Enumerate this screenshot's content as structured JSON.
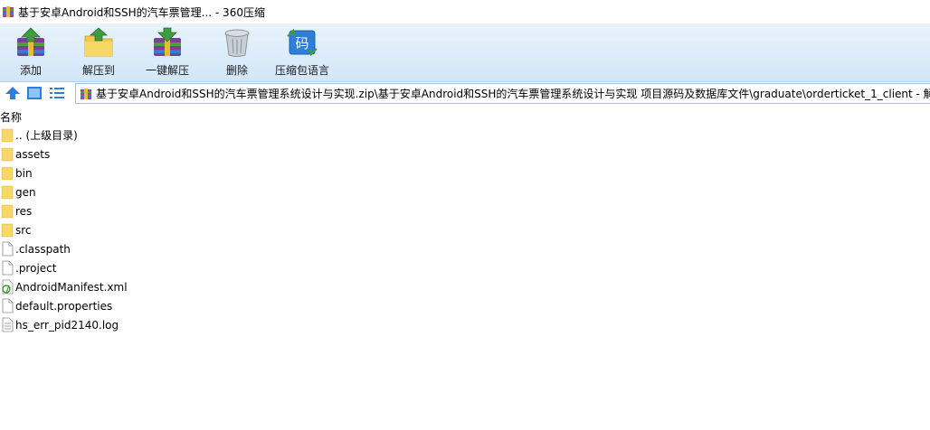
{
  "window": {
    "title": "基于安卓Android和SSH的汽车票管理... - 360压缩"
  },
  "toolbar": {
    "add_label": "添加",
    "extract_to_label": "解压到",
    "one_click_extract_label": "一键解压",
    "delete_label": "删除",
    "comment_label": "压缩包语言",
    "comment_icon_glyph": "码"
  },
  "address": {
    "path": "基于安卓Android和SSH的汽车票管理系统设计与实现.zip\\基于安卓Android和SSH的汽车票管理系统设计与实现 项目源码及数据库文件\\graduate\\orderticket_1_client - 解"
  },
  "list": {
    "column_name": "名称",
    "items": [
      {
        "name": ".. (上级目录)",
        "icon": "folder-icon"
      },
      {
        "name": "assets",
        "icon": "folder-icon"
      },
      {
        "name": "bin",
        "icon": "folder-icon"
      },
      {
        "name": "gen",
        "icon": "folder-icon"
      },
      {
        "name": "res",
        "icon": "folder-icon"
      },
      {
        "name": "src",
        "icon": "folder-icon"
      },
      {
        "name": ".classpath",
        "icon": "file-icon"
      },
      {
        "name": ".project",
        "icon": "file-icon"
      },
      {
        "name": "AndroidManifest.xml",
        "icon": "xml-file-icon"
      },
      {
        "name": "default.properties",
        "icon": "file-icon"
      },
      {
        "name": "hs_err_pid2140.log",
        "icon": "log-file-icon"
      }
    ]
  },
  "colors": {
    "toolbar_top": "#e8f3fd",
    "toolbar_bottom": "#d2e6f8",
    "folder": "#f7d766",
    "accent_blue": "#2f7fd8"
  }
}
